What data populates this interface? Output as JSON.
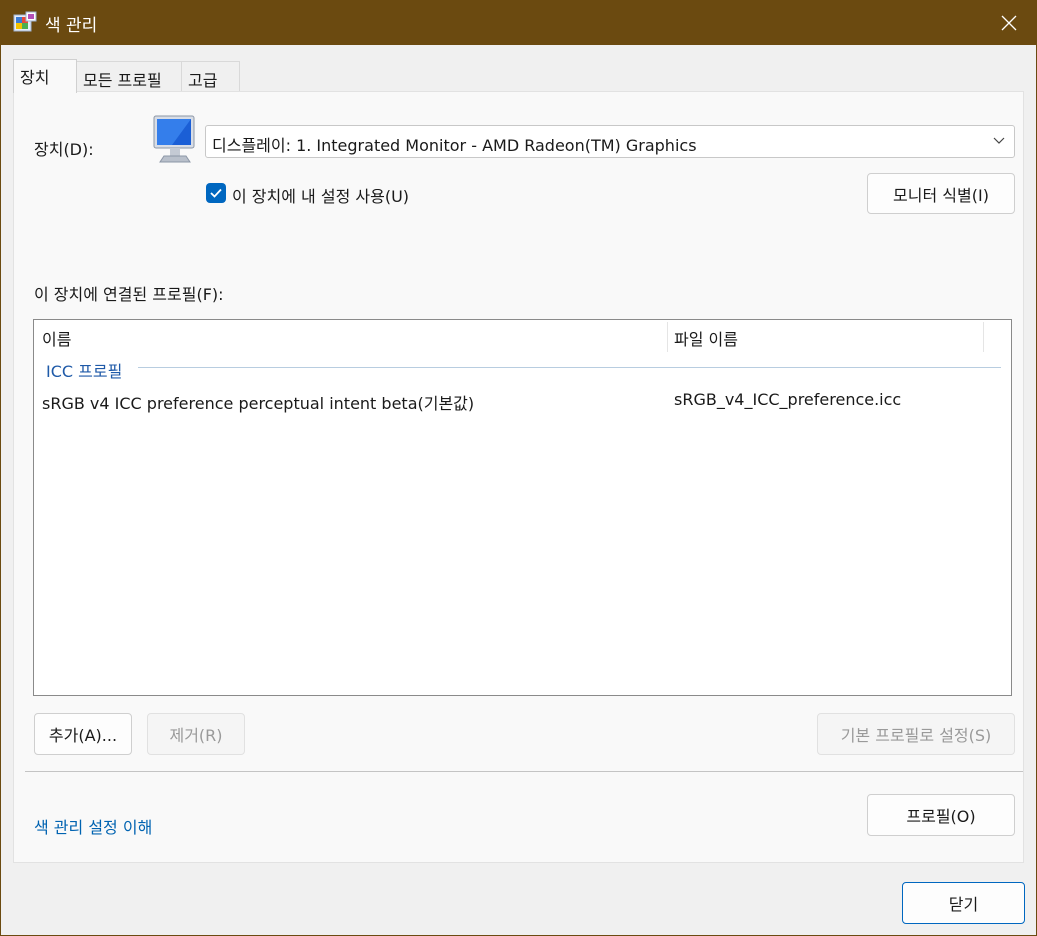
{
  "window": {
    "title": "색 관리",
    "close_icon": "close-icon"
  },
  "tabs": [
    {
      "label": "장치",
      "active": true
    },
    {
      "label": "모든 프로필",
      "active": false
    },
    {
      "label": "고급",
      "active": false
    }
  ],
  "device": {
    "label": "장치(D):",
    "selected": "디스플레이: 1. Integrated Monitor - AMD Radeon(TM) Graphics",
    "use_settings_label": "이 장치에 내 설정 사용(U)",
    "use_settings_checked": true,
    "identify_button": "모니터 식별(I)"
  },
  "profiles": {
    "label": "이 장치에 연결된 프로필(F):",
    "columns": [
      "이름",
      "파일 이름"
    ],
    "group": "ICC 프로필",
    "rows": [
      {
        "name": "sRGB v4 ICC preference perceptual intent beta(기본값)",
        "file": "sRGB_v4_ICC_preference.icc"
      }
    ]
  },
  "buttons": {
    "add": "추가(A)...",
    "remove": "제거(R)",
    "set_default": "기본 프로필로 설정(S)",
    "profile": "프로필(O)",
    "close": "닫기"
  },
  "link": "색 관리 설정 이해",
  "colors": {
    "titlebar": "#6b4a10",
    "accent": "#0067c0",
    "link": "#0063b1"
  }
}
